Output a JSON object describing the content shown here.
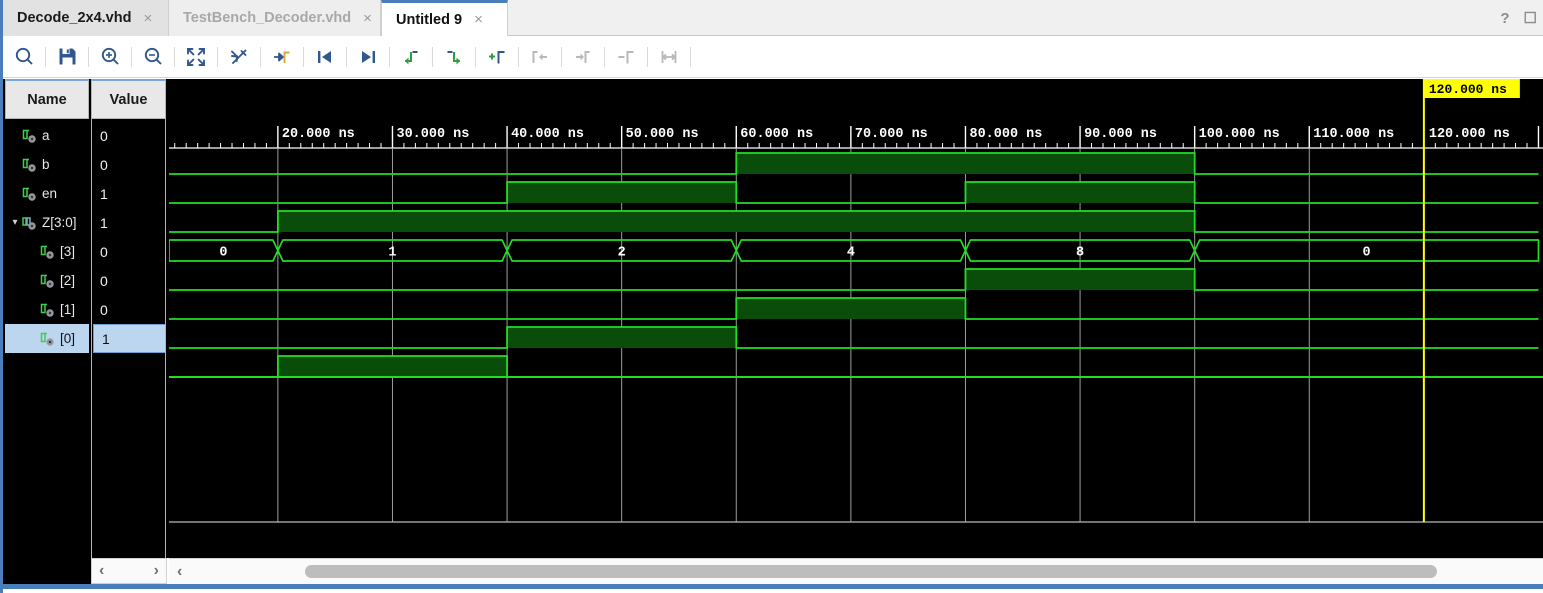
{
  "window": {
    "help_icon": "question-mark",
    "maximize_icon": "maximize-square"
  },
  "tabs": [
    {
      "label": "Decode_2x4.vhd",
      "close": "×",
      "state": "inactive"
    },
    {
      "label": "TestBench_Decoder.vhd",
      "close": "×",
      "state": "inactive-dim"
    },
    {
      "label": "Untitled 9",
      "close": "×",
      "state": "active"
    }
  ],
  "toolbar": {
    "buttons": [
      {
        "name": "search-icon",
        "enabled": true
      },
      {
        "name": "save-icon",
        "enabled": true
      },
      {
        "name": "zoom-in-icon",
        "enabled": true
      },
      {
        "name": "zoom-out-icon",
        "enabled": true
      },
      {
        "name": "zoom-fit-icon",
        "enabled": true
      },
      {
        "name": "zoom-cancel-icon",
        "enabled": true
      },
      {
        "name": "goto-time-icon",
        "enabled": true
      },
      {
        "name": "previous-marker-icon",
        "enabled": true
      },
      {
        "name": "next-marker-icon",
        "enabled": true
      },
      {
        "name": "previous-transition-icon",
        "enabled": true
      },
      {
        "name": "next-transition-icon",
        "enabled": true
      },
      {
        "name": "add-marker-icon",
        "enabled": true
      },
      {
        "name": "previous-edge-icon",
        "enabled": false
      },
      {
        "name": "next-edge-icon",
        "enabled": false
      },
      {
        "name": "remove-marker-icon",
        "enabled": false
      },
      {
        "name": "measure-icon",
        "enabled": false
      }
    ]
  },
  "columns": {
    "name_header": "Name",
    "value_header": "Value"
  },
  "signals": [
    {
      "name": "a",
      "value": "0",
      "indent": 0,
      "icon": "wave-signal-icon",
      "selected": false,
      "expandable": false
    },
    {
      "name": "b",
      "value": "0",
      "indent": 0,
      "icon": "wave-signal-icon",
      "selected": false,
      "expandable": false
    },
    {
      "name": "en",
      "value": "1",
      "indent": 0,
      "icon": "wave-signal-icon",
      "selected": false,
      "expandable": false
    },
    {
      "name": "Z[3:0]",
      "value": "1",
      "indent": 0,
      "icon": "wave-bus-icon",
      "selected": false,
      "expandable": true,
      "expanded": true
    },
    {
      "name": "[3]",
      "value": "0",
      "indent": 1,
      "icon": "wave-signal-icon",
      "selected": false,
      "expandable": false
    },
    {
      "name": "[2]",
      "value": "0",
      "indent": 1,
      "icon": "wave-signal-icon",
      "selected": false,
      "expandable": false
    },
    {
      "name": "[1]",
      "value": "0",
      "indent": 1,
      "icon": "wave-signal-icon",
      "selected": false,
      "expandable": false
    },
    {
      "name": "[0]",
      "value": "1",
      "indent": 1,
      "icon": "wave-signal-icon",
      "selected": true,
      "expandable": false
    }
  ],
  "cursor": {
    "badge_label": "120.000 ns",
    "ruler_label": "120.000 ns",
    "time_ns": 120,
    "color": "#ffff00"
  },
  "ruler": {
    "unit": "ns",
    "labels": [
      "20.000 ns",
      "30.000 ns",
      "40.000 ns",
      "50.000 ns",
      "60.000 ns",
      "70.000 ns",
      "80.000 ns",
      "90.000 ns",
      "100.000 ns",
      "110.000 ns"
    ],
    "times_ns": [
      20,
      30,
      40,
      50,
      60,
      70,
      80,
      90,
      100,
      110
    ],
    "minor_tick_ns": 1,
    "pixels_per_10ns": 114.6,
    "origin_time_ns": 10.5
  },
  "chart_data": {
    "type": "timing-waveform",
    "title": "Decode_2x4 simulation waveform",
    "time_unit": "ns",
    "time_start": 10.5,
    "time_end": 130,
    "cursor_ns": 120,
    "axis_ticks_ns": [
      20,
      30,
      40,
      50,
      60,
      70,
      80,
      90,
      100,
      110,
      120
    ],
    "signals": [
      {
        "name": "a",
        "type": "digital",
        "transitions": [
          {
            "t": 10.5,
            "v": 0
          },
          {
            "t": 60,
            "v": 1
          },
          {
            "t": 100,
            "v": 0
          }
        ]
      },
      {
        "name": "b",
        "type": "digital",
        "transitions": [
          {
            "t": 10.5,
            "v": 0
          },
          {
            "t": 40,
            "v": 1
          },
          {
            "t": 60,
            "v": 0
          },
          {
            "t": 80,
            "v": 1
          },
          {
            "t": 100,
            "v": 0
          }
        ]
      },
      {
        "name": "en",
        "type": "digital",
        "transitions": [
          {
            "t": 10.5,
            "v": 0
          },
          {
            "t": 20,
            "v": 1
          },
          {
            "t": 100,
            "v": 0
          }
        ]
      },
      {
        "name": "Z[3:0]",
        "type": "bus",
        "segments": [
          {
            "start": 10.5,
            "end": 20,
            "label": "0"
          },
          {
            "start": 20,
            "end": 40,
            "label": "1"
          },
          {
            "start": 40,
            "end": 60,
            "label": "2"
          },
          {
            "start": 60,
            "end": 80,
            "label": "4"
          },
          {
            "start": 80,
            "end": 100,
            "label": "8"
          },
          {
            "start": 100,
            "end": 130,
            "label": "0"
          }
        ]
      },
      {
        "name": "[3]",
        "type": "digital",
        "transitions": [
          {
            "t": 10.5,
            "v": 0
          },
          {
            "t": 80,
            "v": 1
          },
          {
            "t": 100,
            "v": 0
          }
        ]
      },
      {
        "name": "[2]",
        "type": "digital",
        "transitions": [
          {
            "t": 10.5,
            "v": 0
          },
          {
            "t": 60,
            "v": 1
          },
          {
            "t": 80,
            "v": 0
          }
        ]
      },
      {
        "name": "[1]",
        "type": "digital",
        "transitions": [
          {
            "t": 10.5,
            "v": 0
          },
          {
            "t": 40,
            "v": 1
          },
          {
            "t": 60,
            "v": 0
          }
        ]
      },
      {
        "name": "[0]",
        "type": "digital",
        "transitions": [
          {
            "t": 10.5,
            "v": 0
          },
          {
            "t": 20,
            "v": 1
          },
          {
            "t": 40,
            "v": 0
          }
        ]
      }
    ],
    "colors": {
      "background": "#000000",
      "wave_stroke": "#22dd22",
      "wave_fill": "#0a4d0a",
      "gridline": "#b9b9b9",
      "text": "#ffffff",
      "cursor": "#ffff00"
    }
  },
  "scrollbars": {
    "left_prev": "‹",
    "left_next": "›",
    "right_prev": "‹",
    "thumb_left_pct": 9,
    "thumb_width_pct": 83
  }
}
